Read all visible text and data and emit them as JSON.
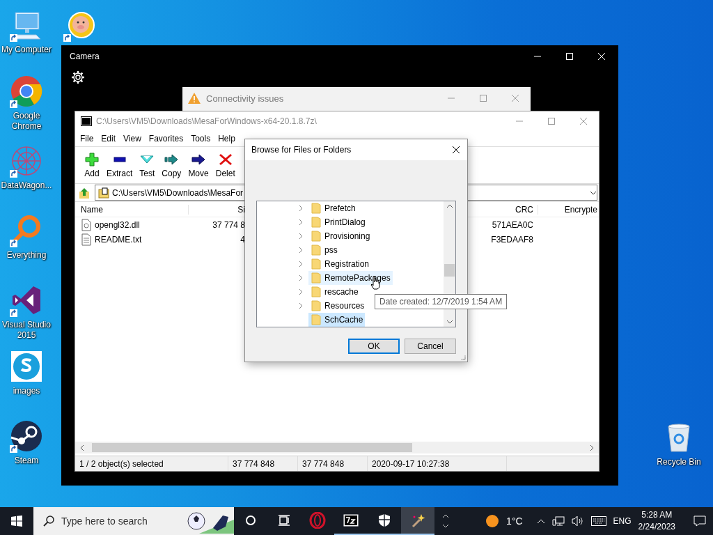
{
  "desktop_icons": [
    {
      "kind": "computer",
      "label": "My Computer"
    },
    {
      "kind": "pig"
    },
    {
      "kind": "chrome",
      "label": "Google Chrome"
    },
    {
      "kind": "datawagon",
      "label": "DataWagon..."
    },
    {
      "kind": "everything",
      "label": "Everything"
    },
    {
      "kind": "visualstudio",
      "label": "Visual Studio 2015"
    },
    {
      "kind": "skype",
      "label": "images"
    },
    {
      "kind": "steam",
      "label": "Steam"
    },
    {
      "kind": "recyclebin",
      "label": "Recycle Bin"
    }
  ],
  "camera_window": {
    "title": "Camera"
  },
  "connectivity_window": {
    "title": "Connectivity issues"
  },
  "archive_window": {
    "title": "C:\\Users\\VM5\\Downloads\\MesaForWindows-x64-20.1.8.7z\\",
    "menu": [
      "File",
      "Edit",
      "View",
      "Favorites",
      "Tools",
      "Help"
    ],
    "toolbar": [
      {
        "kind": "add",
        "label": "Add"
      },
      {
        "kind": "extract",
        "label": "Extract"
      },
      {
        "kind": "test",
        "label": "Test"
      },
      {
        "kind": "copy",
        "label": "Copy"
      },
      {
        "kind": "move",
        "label": "Move"
      },
      {
        "kind": "delete",
        "label": "Delet"
      }
    ],
    "address": "C:\\Users\\VM5\\Downloads\\MesaFor",
    "columns": [
      "Name",
      "Si",
      "CRC",
      "Encrypte"
    ],
    "rows": [
      {
        "kind": "dll",
        "name": "opengl32.dll",
        "size": "37 774 8",
        "crc": "571AEA0C"
      },
      {
        "kind": "text",
        "name": "README.txt",
        "size": "4",
        "crc": "F3EDAAF8"
      }
    ],
    "status_bar": [
      "1 / 2 object(s) selected",
      "37 774 848",
      "37 774 848",
      "2020-09-17 10:27:38"
    ]
  },
  "dialog": {
    "title": "Browse for Files or Folders",
    "tree": [
      {
        "label": "Prefetch",
        "expandable": true,
        "hovered": false,
        "selected": false
      },
      {
        "label": "PrintDialog",
        "expandable": true,
        "hovered": false,
        "selected": false
      },
      {
        "label": "Provisioning",
        "expandable": true,
        "hovered": false,
        "selected": false
      },
      {
        "label": "pss",
        "expandable": true,
        "hovered": false,
        "selected": false
      },
      {
        "label": "Registration",
        "expandable": true,
        "hovered": false,
        "selected": false
      },
      {
        "label": "RemotePackages",
        "expandable": true,
        "hovered": true,
        "selected": false
      },
      {
        "label": "rescache",
        "expandable": true,
        "hovered": false,
        "selected": false
      },
      {
        "label": "Resources",
        "expandable": true,
        "hovered": false,
        "selected": false
      },
      {
        "label": "SchCache",
        "expandable": false,
        "hovered": false,
        "selected": true
      }
    ],
    "tooltip": "Date created: 12/7/2019 1:54 AM",
    "buttons": [
      {
        "label": "OK",
        "default": true
      },
      {
        "label": "Cancel",
        "default": false
      }
    ]
  },
  "taskbar": {
    "search": {
      "placeholder": "Type here to search"
    },
    "apps": [
      {
        "kind": "cortana",
        "running": false,
        "active": false
      },
      {
        "kind": "taskview",
        "running": false,
        "active": false
      },
      {
        "kind": "opera",
        "running": false,
        "active": false
      },
      {
        "kind": "sevenzip",
        "running": true,
        "active": false
      },
      {
        "kind": "defender",
        "running": true,
        "active": false
      },
      {
        "kind": "wand",
        "running": true,
        "active": true
      }
    ],
    "weather": "1°C",
    "language": "ENG",
    "time": "5:28 AM",
    "date": "2/24/2023"
  }
}
